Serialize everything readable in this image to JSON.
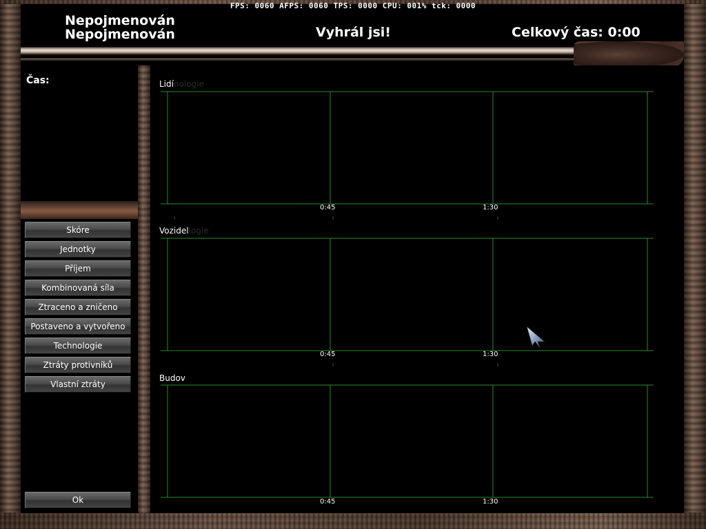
{
  "stats": "FPS: 0060 AFPS: 0060 TPS: 0000 CPU: 001% tck: 0000",
  "header": {
    "player1": "Nepojmenován",
    "player2": "Nepojmenován",
    "result": "Vyhrál jsi!",
    "total_time": "Celkový čas: 0:00"
  },
  "sidebar": {
    "time_label": "Čas:",
    "buttons": [
      "Skóre",
      "Jednotky",
      "Příjem",
      "Kombinovaná síla",
      "Ztraceno a zničeno",
      "Postaveno a vytvořeno",
      "Technologie",
      "Ztráty protivníků",
      "Vlastní ztráty"
    ],
    "ok": "Ok"
  },
  "graphs": [
    {
      "title": "Lidí",
      "ghost": "nologie",
      "ticks": [
        "0:45",
        "1:30"
      ]
    },
    {
      "title": "Vozidel",
      "ghost": "logie",
      "ticks": [
        "0:45",
        "1:30"
      ]
    },
    {
      "title": "Budov",
      "ghost": "",
      "ticks": [
        "0:45",
        "1:30"
      ]
    }
  ],
  "colors": {
    "grid": "#2d8a2d",
    "background": "#000000"
  },
  "icons": {
    "cursor": "arrow-cursor-icon"
  }
}
